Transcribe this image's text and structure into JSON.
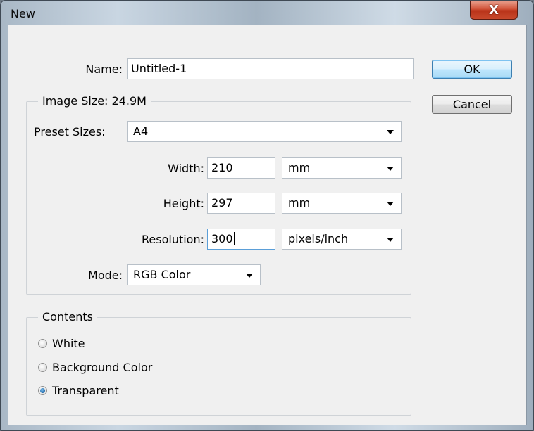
{
  "window": {
    "title": "New",
    "close_glyph": "X"
  },
  "name_row": {
    "label": "Name:",
    "value": "Untitled-1"
  },
  "buttons": {
    "ok": "OK",
    "cancel": "Cancel"
  },
  "image_size": {
    "legend": "Image Size: 24.9M",
    "preset_label": "Preset Sizes:",
    "preset_value": "A4",
    "width_label": "Width:",
    "width_value": "210",
    "width_unit": "mm",
    "height_label": "Height:",
    "height_value": "297",
    "height_unit": "mm",
    "resolution_label": "Resolution:",
    "resolution_value": "300",
    "resolution_unit": "pixels/inch",
    "mode_label": "Mode:",
    "mode_value": "RGB Color"
  },
  "contents": {
    "legend": "Contents",
    "options": [
      {
        "label": "White",
        "checked": false
      },
      {
        "label": "Background Color",
        "checked": false
      },
      {
        "label": "Transparent",
        "checked": true
      }
    ]
  }
}
